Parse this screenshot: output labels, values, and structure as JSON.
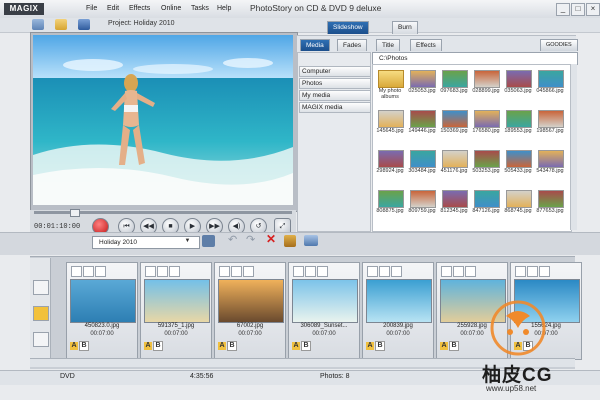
{
  "app": {
    "logo": "MAGIX",
    "title": "PhotoStory on CD & DVD 9 deluxe",
    "window_controls": [
      "_",
      "□",
      "×"
    ]
  },
  "menu": [
    "File",
    "Edit",
    "Effects",
    "Online",
    "Tasks",
    "Help"
  ],
  "project": {
    "label": "Project: Holiday 2010"
  },
  "transport": {
    "timecode": "00:01:10:00"
  },
  "browser": {
    "mode_tabs": [
      "Slideshow",
      "Burn"
    ],
    "tabs": [
      "Media",
      "Fades",
      "Title",
      "Effects"
    ],
    "goodies": "GOODIES",
    "sidebar": [
      "Computer",
      "Photos",
      "My media",
      "MAGIX media"
    ],
    "path": "C:\\Photos",
    "files": [
      {
        "name": "My photo albums"
      },
      {
        "name": "025053.jpg"
      },
      {
        "name": "097683.jpg"
      },
      {
        "name": "028899.jpg"
      },
      {
        "name": "035063.jpg"
      },
      {
        "name": "045866.jpg"
      },
      {
        "name": "145645.jpg"
      },
      {
        "name": "149446.jpg"
      },
      {
        "name": "150369.jpg"
      },
      {
        "name": "176580.jpg"
      },
      {
        "name": "189553.jpg"
      },
      {
        "name": "198567.jpg"
      },
      {
        "name": "298924.jpg"
      },
      {
        "name": "303484.jpg"
      },
      {
        "name": "451176.jpg"
      },
      {
        "name": "503253.jpg"
      },
      {
        "name": "505433.jpg"
      },
      {
        "name": "543478.jpg"
      },
      {
        "name": "808875.jpg"
      },
      {
        "name": "809759.jpg"
      },
      {
        "name": "812345.jpg"
      },
      {
        "name": "847126.jpg"
      },
      {
        "name": "868745.jpg"
      },
      {
        "name": "877653.jpg"
      }
    ]
  },
  "album": {
    "name": "Holiday 2010"
  },
  "timeline": {
    "slides": [
      {
        "caption": "450823.0.jpg",
        "duration": "00:07:00"
      },
      {
        "caption": "591375_1.jpg",
        "duration": "00:07:00"
      },
      {
        "caption": "67002.jpg",
        "duration": "00:07:00"
      },
      {
        "caption": "306089_Sunset...",
        "duration": "00:07:00"
      },
      {
        "caption": "200839.jpg",
        "duration": "00:07:00"
      },
      {
        "caption": "255928.jpg",
        "duration": "00:07:00"
      },
      {
        "caption": "155624.jpg",
        "duration": "00:07:00"
      }
    ],
    "ab_labels": [
      "A",
      "B"
    ]
  },
  "status": {
    "disc": "DVD",
    "time": "4:35:56",
    "photos": "Photos: 8"
  },
  "watermark": {
    "brand": "柚皮CG",
    "url": "www.up58.net"
  },
  "colors": {
    "accent": "#1c4f8c",
    "record": "#d62020"
  }
}
